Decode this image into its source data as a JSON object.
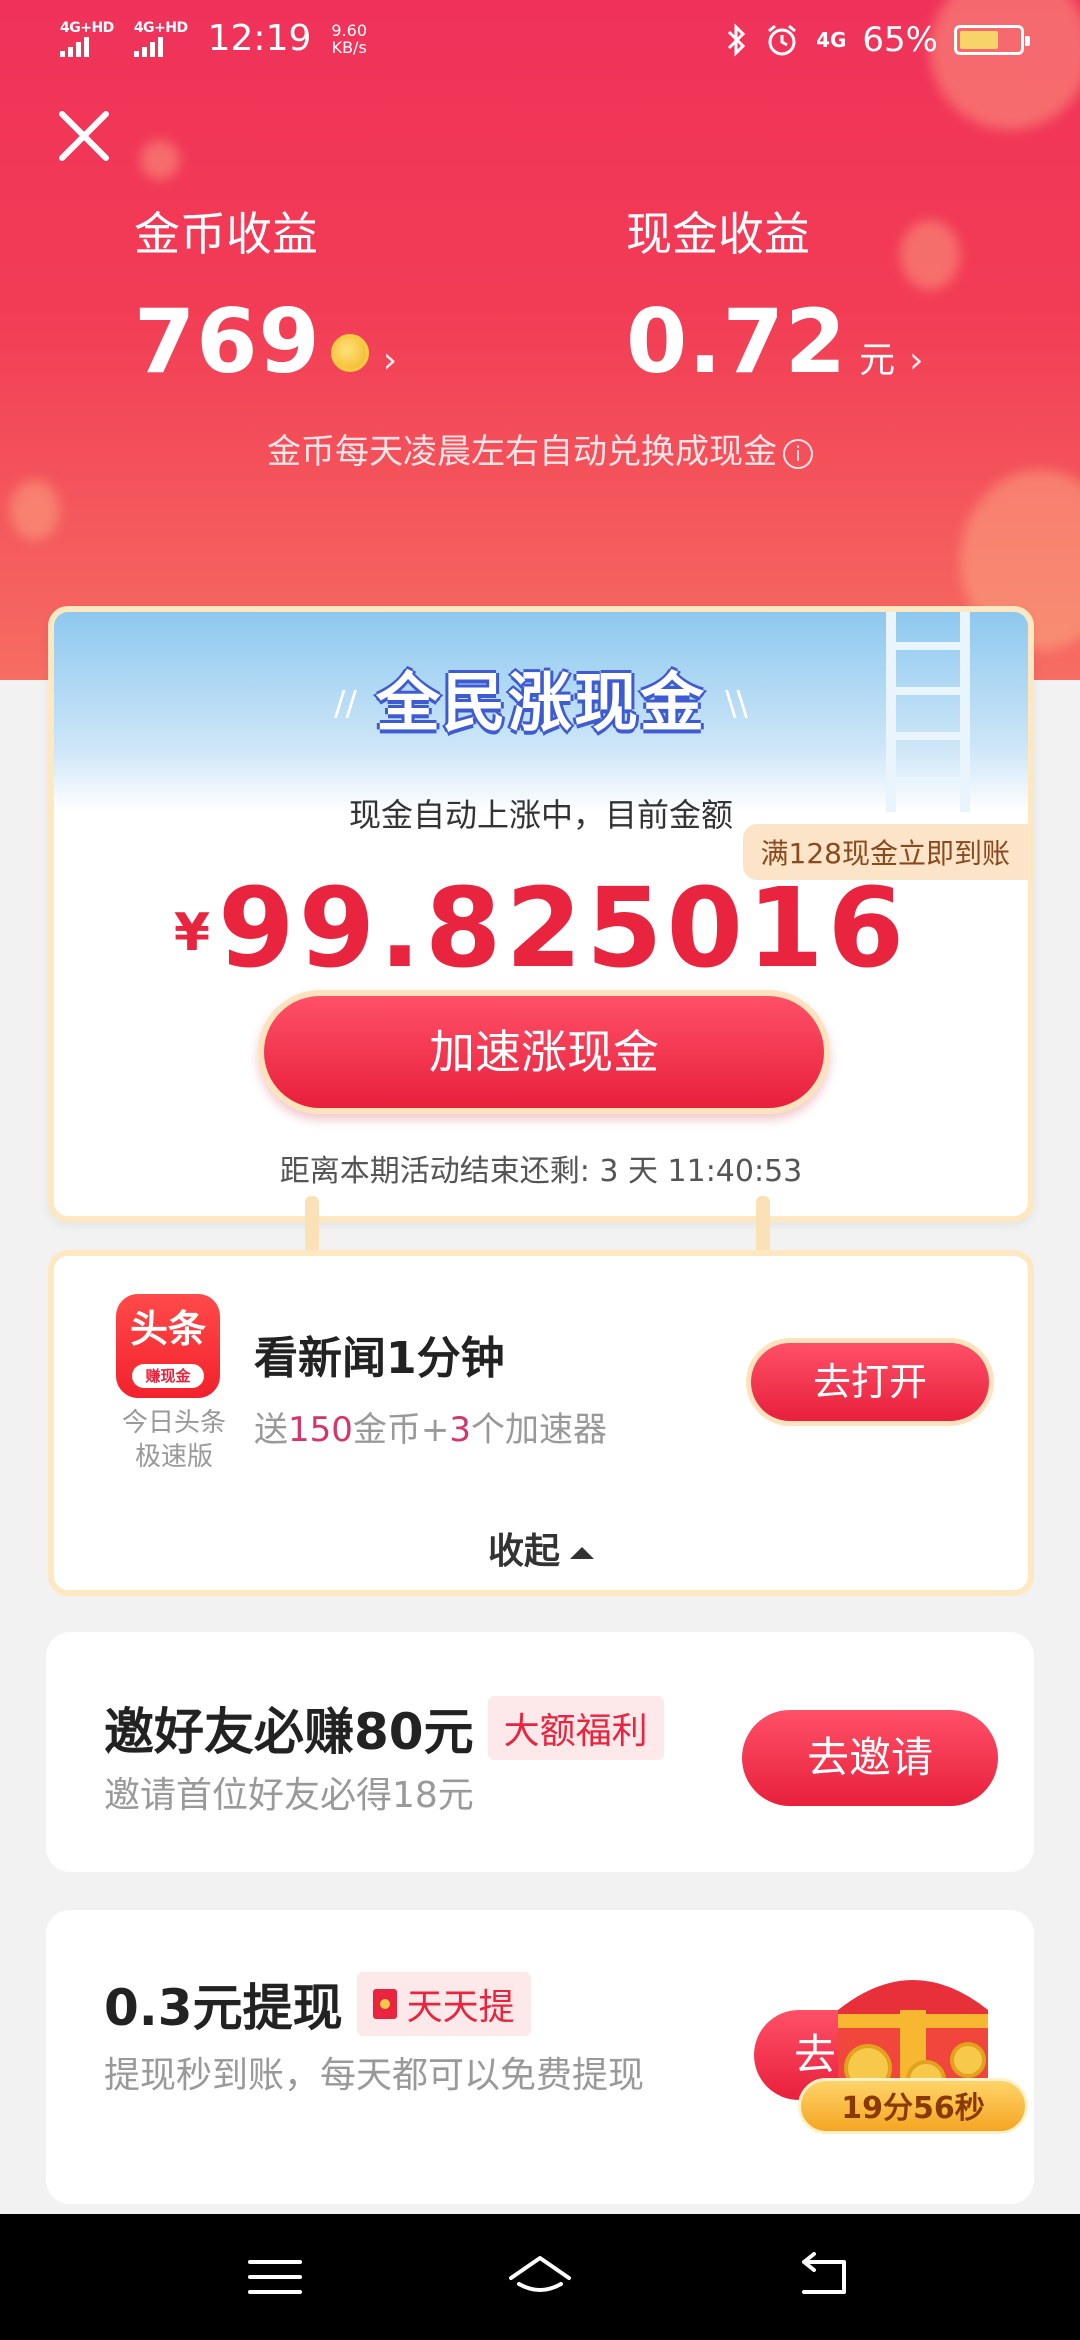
{
  "status": {
    "sim1": "4G+HD",
    "sim2": "4G+HD",
    "time": "12:19",
    "speed_value": "9.60",
    "speed_unit": "KB/s",
    "net": "4G",
    "battery": "65%",
    "battery_level": 0.65
  },
  "summary": {
    "coin_label": "金币收益",
    "coin_value": "769",
    "cash_label": "现金收益",
    "cash_value": "0.72",
    "cash_unit": "元",
    "note": "金币每天凌晨左右自动兑换成现金"
  },
  "promo": {
    "title": "全民涨现金",
    "subtitle": "现金自动上涨中，目前金额",
    "badge": "满128现金立即到账",
    "currency": "¥",
    "amount": "99.825016",
    "button": "加速涨现金",
    "countdown": "距离本期活动结束还剩: 3 天 11:40:53"
  },
  "task": {
    "icon_text": "头条",
    "icon_badge": "赚现金",
    "app_name_line1": "今日头条",
    "app_name_line2": "极速版",
    "title": "看新闻1分钟",
    "desc_prefix": "送",
    "desc_coins": "150",
    "desc_mid": "金币+",
    "desc_count": "3",
    "desc_suffix": "个加速器",
    "button": "去打开",
    "collapse": "收起"
  },
  "invite": {
    "title": "邀好友必赚80元",
    "tag": "大额福利",
    "subtitle": "邀请首位好友必得18元",
    "button": "去邀请"
  },
  "withdraw": {
    "title": "0.3元提现",
    "tag": "天天提",
    "subtitle": "提现秒到账，每天都可以免费提现",
    "button": "去",
    "timer": "19分56秒"
  },
  "colors": {
    "header_top": "#f0325a",
    "accent": "#e8243e",
    "gold": "#f2b321",
    "card_border": "#fde8c2"
  }
}
